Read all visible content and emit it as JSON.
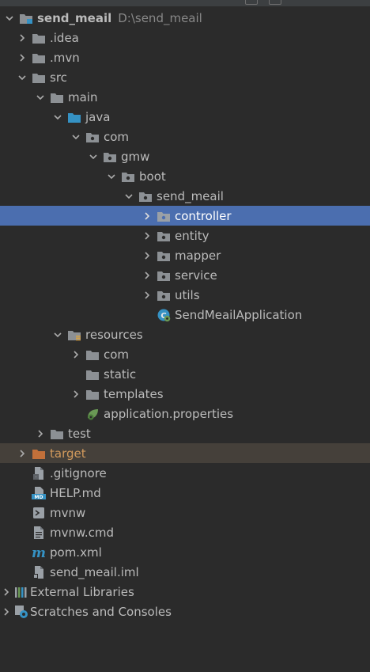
{
  "project": {
    "name": "send_meail",
    "path": "D:\\send_meail"
  },
  "tree": {
    "idea": ".idea",
    "mvn": ".mvn",
    "src": "src",
    "main": "main",
    "java": "java",
    "com": "com",
    "gmw": "gmw",
    "boot": "boot",
    "send_meail": "send_meail",
    "controller": "controller",
    "entity": "entity",
    "mapper": "mapper",
    "service": "service",
    "utils": "utils",
    "app_class": "SendMeailApplication",
    "resources": "resources",
    "res_com": "com",
    "static": "static",
    "templates": "templates",
    "app_properties": "application.properties",
    "test": "test",
    "target": "target",
    "gitignore": ".gitignore",
    "help": "HELP.md",
    "mvnw": "mvnw",
    "mvnw_cmd": "mvnw.cmd",
    "pom": "pom.xml",
    "iml": "send_meail.iml",
    "external_libraries": "External Libraries",
    "scratches": "Scratches and Consoles"
  },
  "colors": {
    "background": "#2b2b2b",
    "selection": "#4b6eaf",
    "excluded_row": "#45403a",
    "folder": "#8c9094",
    "source_folder": "#3592c4",
    "excluded_folder": "#c2703a",
    "text": "#bbbbbb"
  }
}
